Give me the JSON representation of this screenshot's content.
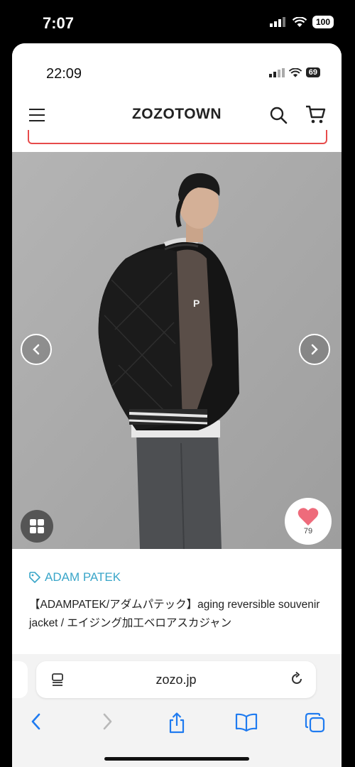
{
  "outer_status": {
    "time": "7:07",
    "battery": "100"
  },
  "inner_status": {
    "time": "22:09",
    "battery": "69"
  },
  "header": {
    "logo": "ZOZOTOWN"
  },
  "product": {
    "favorite_count": "79",
    "brand": "ADAM PATEK",
    "title": "【ADAMPATEK/アダムパテック】aging reversible souvenir jacket / エイジング加工ベロアスカジャン"
  },
  "browser": {
    "url": "zozo.jp"
  },
  "colors": {
    "brand": "#3aa6c9",
    "heart": "#ee6b7b",
    "accent_red": "#e74b4b",
    "ios_blue": "#1f7bf0"
  }
}
